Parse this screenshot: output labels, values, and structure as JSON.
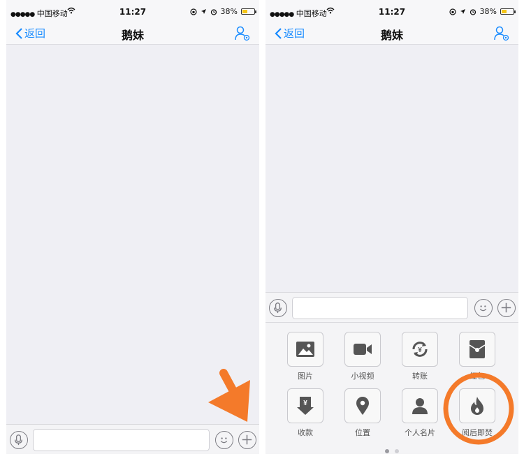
{
  "status_bar": {
    "signal": "●●●●●",
    "carrier": "中国移动",
    "time": "11:27",
    "battery": "38%",
    "battery_level": 0.38,
    "battery_color": "#f5c518"
  },
  "nav": {
    "back_label": "返回",
    "title": "鹅妹",
    "accent": "#1a8cff"
  },
  "panel": {
    "items": [
      {
        "label": "图片",
        "icon": "image-icon"
      },
      {
        "label": "小视频",
        "icon": "video-icon"
      },
      {
        "label": "转账",
        "icon": "transfer-icon"
      },
      {
        "label": "红包",
        "icon": "red-envelope-icon"
      },
      {
        "label": "收款",
        "icon": "receive-money-icon"
      },
      {
        "label": "位置",
        "icon": "location-icon"
      },
      {
        "label": "个人名片",
        "icon": "contact-card-icon"
      },
      {
        "label": "阅后即焚",
        "icon": "flame-icon"
      }
    ],
    "page_count": 2,
    "current_page": 1
  },
  "annotation_colors": {
    "arrow": "#f47a2a",
    "circle": "#f47a2a"
  }
}
